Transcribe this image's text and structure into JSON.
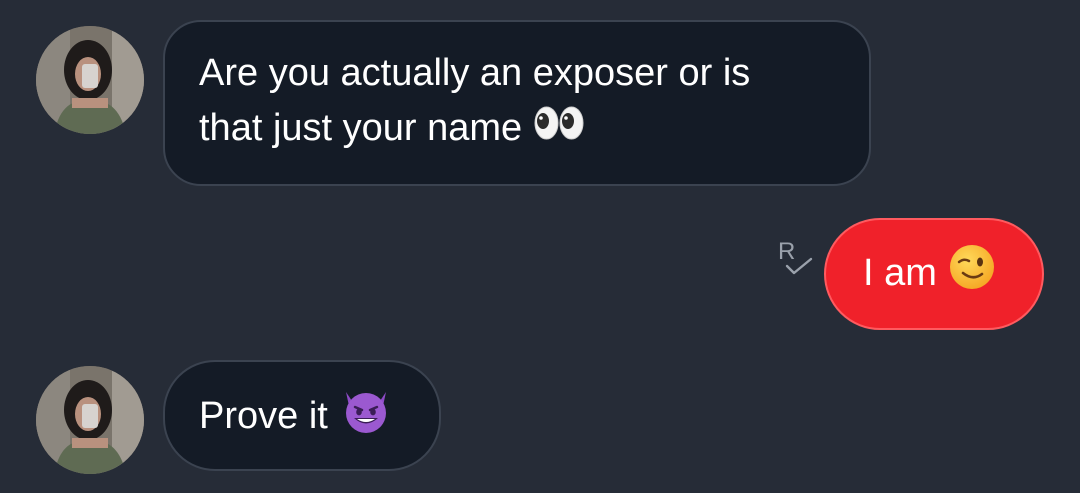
{
  "messages": [
    {
      "direction": "incoming",
      "text_line1": "Are you actually an exposer or is",
      "text_line2": "that just your name",
      "emoji": "eyes-emoji"
    },
    {
      "direction": "outgoing",
      "text": "I am",
      "emoji": "winking-face-emoji",
      "receipt": "R"
    },
    {
      "direction": "incoming",
      "text": "Prove it",
      "emoji": "smiling-devil-emoji"
    }
  ],
  "colors": {
    "background": "#262c37",
    "incoming_bubble": "#141b26",
    "incoming_border": "#3b4350",
    "outgoing_bubble": "#f0212a",
    "text": "#ffffff",
    "receipt": "#9aa1ab"
  }
}
